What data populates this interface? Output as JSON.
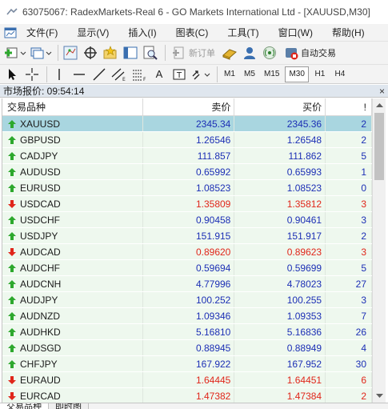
{
  "window": {
    "title": "63075067: RadexMarkets-Real 6 - GO Markets International Ltd - [XAUUSD,M30]"
  },
  "menu": {
    "items": [
      "文件(F)",
      "显示(V)",
      "插入(I)",
      "图表(C)",
      "工具(T)",
      "窗口(W)",
      "帮助(H)"
    ]
  },
  "toolbar": {
    "new_order_label": "新订单",
    "auto_trading_label": "自动交易",
    "text_tool_label": "A",
    "timeframes": [
      "M1",
      "M5",
      "M15",
      "M30",
      "H1",
      "H4"
    ],
    "active_timeframe": "M30"
  },
  "market_watch": {
    "title": "市场报价: 09:54:14",
    "close_label": "×",
    "columns": {
      "symbol": "交易品种",
      "bid": "卖价",
      "ask": "买价",
      "spread": "!"
    },
    "rows": [
      {
        "symbol": "XAUUSD",
        "bid": "2345.34",
        "ask": "2345.36",
        "spread": "2",
        "dir": "up",
        "color": "#1c2fb5",
        "selected": true
      },
      {
        "symbol": "GBPUSD",
        "bid": "1.26546",
        "ask": "1.26548",
        "spread": "2",
        "dir": "up",
        "color": "#1c2fb5"
      },
      {
        "symbol": "CADJPY",
        "bid": "111.857",
        "ask": "111.862",
        "spread": "5",
        "dir": "up",
        "color": "#1c2fb5"
      },
      {
        "symbol": "AUDUSD",
        "bid": "0.65992",
        "ask": "0.65993",
        "spread": "1",
        "dir": "up",
        "color": "#1c2fb5"
      },
      {
        "symbol": "EURUSD",
        "bid": "1.08523",
        "ask": "1.08523",
        "spread": "0",
        "dir": "up",
        "color": "#1c2fb5"
      },
      {
        "symbol": "USDCAD",
        "bid": "1.35809",
        "ask": "1.35812",
        "spread": "3",
        "dir": "down",
        "color": "#e0261a"
      },
      {
        "symbol": "USDCHF",
        "bid": "0.90458",
        "ask": "0.90461",
        "spread": "3",
        "dir": "up",
        "color": "#1c2fb5"
      },
      {
        "symbol": "USDJPY",
        "bid": "151.915",
        "ask": "151.917",
        "spread": "2",
        "dir": "up",
        "color": "#1c2fb5"
      },
      {
        "symbol": "AUDCAD",
        "bid": "0.89620",
        "ask": "0.89623",
        "spread": "3",
        "dir": "down",
        "color": "#e0261a"
      },
      {
        "symbol": "AUDCHF",
        "bid": "0.59694",
        "ask": "0.59699",
        "spread": "5",
        "dir": "up",
        "color": "#1c2fb5"
      },
      {
        "symbol": "AUDCNH",
        "bid": "4.77996",
        "ask": "4.78023",
        "spread": "27",
        "dir": "up",
        "color": "#1c2fb5"
      },
      {
        "symbol": "AUDJPY",
        "bid": "100.252",
        "ask": "100.255",
        "spread": "3",
        "dir": "up",
        "color": "#1c2fb5"
      },
      {
        "symbol": "AUDNZD",
        "bid": "1.09346",
        "ask": "1.09353",
        "spread": "7",
        "dir": "up",
        "color": "#1c2fb5"
      },
      {
        "symbol": "AUDHKD",
        "bid": "5.16810",
        "ask": "5.16836",
        "spread": "26",
        "dir": "up",
        "color": "#1c2fb5"
      },
      {
        "symbol": "AUDSGD",
        "bid": "0.88945",
        "ask": "0.88949",
        "spread": "4",
        "dir": "up",
        "color": "#1c2fb5"
      },
      {
        "symbol": "CHFJPY",
        "bid": "167.922",
        "ask": "167.952",
        "spread": "30",
        "dir": "up",
        "color": "#1c2fb5"
      },
      {
        "symbol": "EURAUD",
        "bid": "1.64445",
        "ask": "1.64451",
        "spread": "6",
        "dir": "down",
        "color": "#e0261a"
      },
      {
        "symbol": "EURCAD",
        "bid": "1.47382",
        "ask": "1.47384",
        "spread": "2",
        "dir": "down",
        "color": "#e0261a"
      }
    ]
  },
  "tabs": [
    "交易品种",
    "即时图"
  ],
  "colors": {
    "up_arrow": "#2da82d",
    "down_arrow": "#e0261a",
    "selected_row": "#a9d6e0",
    "row_bg": "#eef8ee"
  }
}
